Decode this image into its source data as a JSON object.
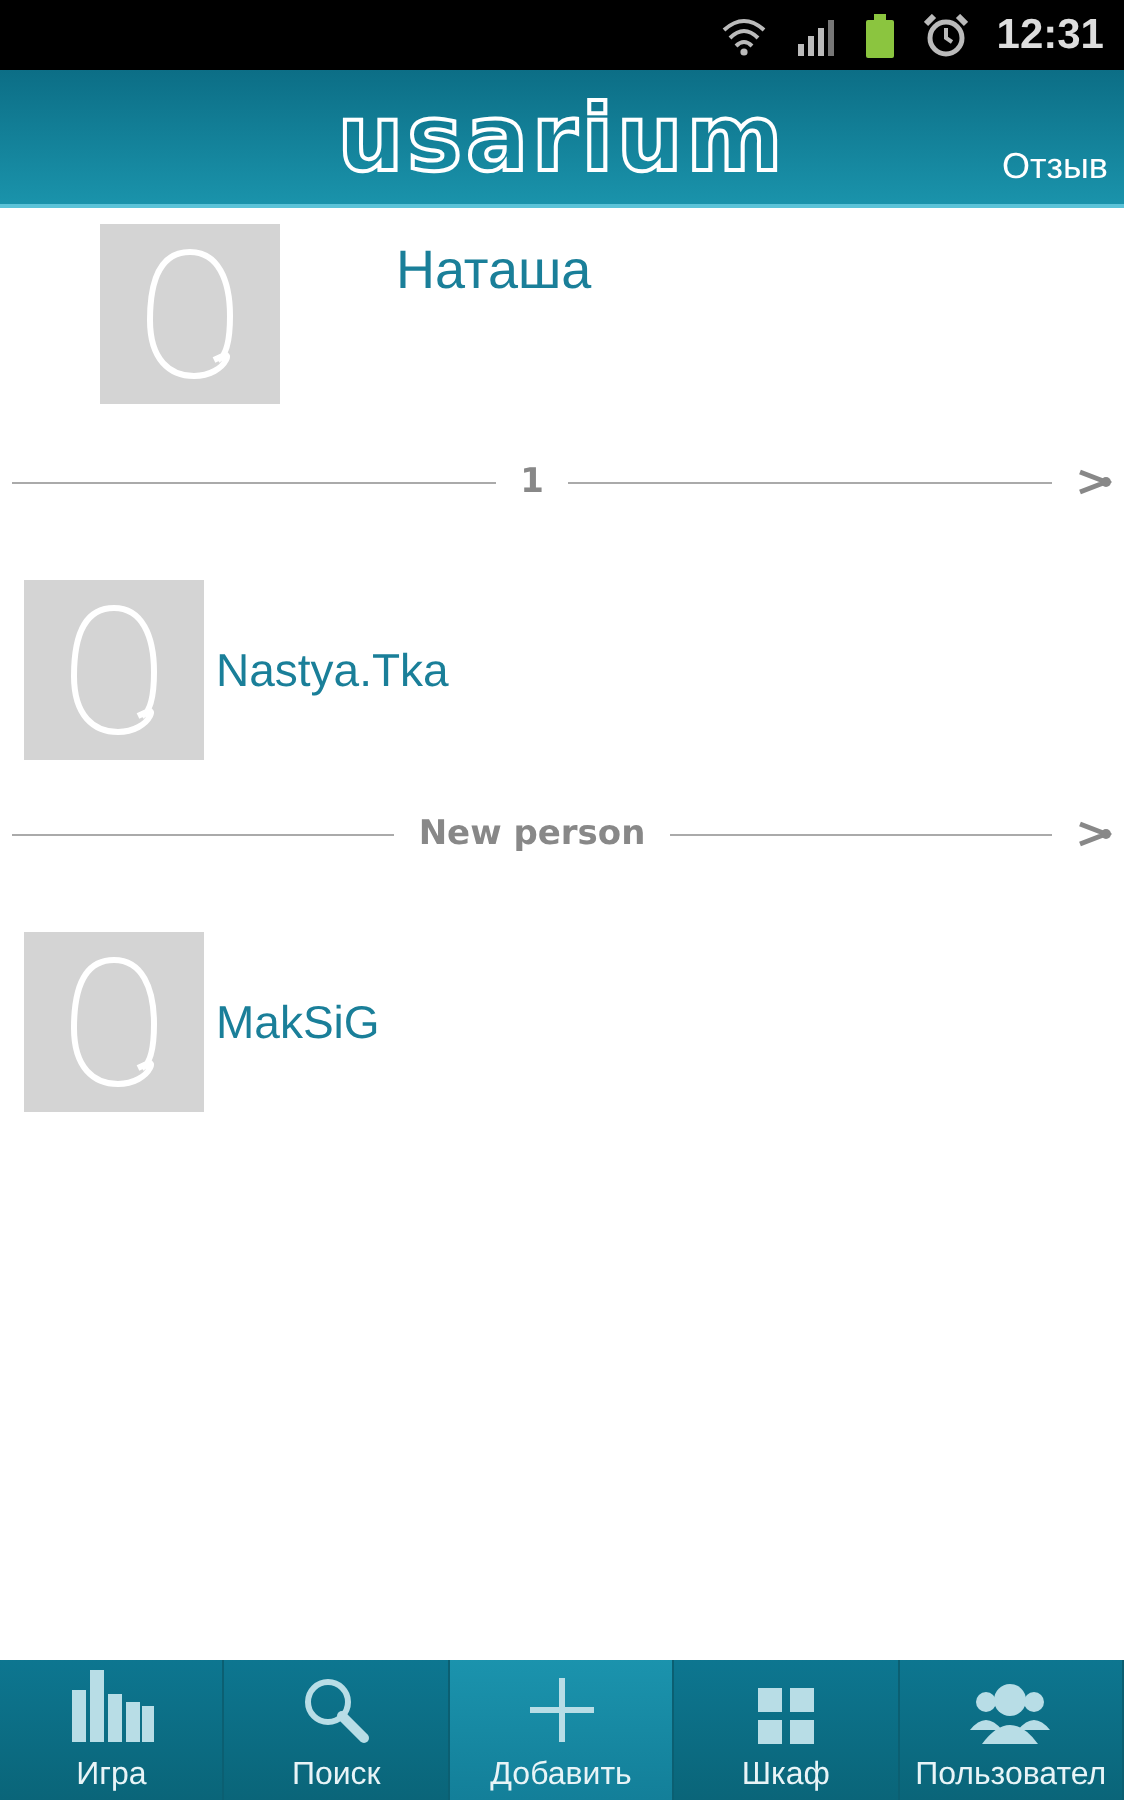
{
  "status_bar": {
    "time": "12:31"
  },
  "header": {
    "logo": "usarium",
    "action": "Отзыв"
  },
  "featured": {
    "name": "Наташа"
  },
  "sections": [
    {
      "label": "1",
      "people": [
        {
          "name": "Nastya.Tka"
        }
      ]
    },
    {
      "label": "New person",
      "people": [
        {
          "name": "MakSiG"
        }
      ]
    }
  ],
  "nav": [
    {
      "kind": "game",
      "label": "Игра",
      "selected": false
    },
    {
      "kind": "search",
      "label": "Поиск",
      "selected": false
    },
    {
      "kind": "add",
      "label": "Добавить",
      "selected": true
    },
    {
      "kind": "grid",
      "label": "Шкаф",
      "selected": false
    },
    {
      "kind": "users",
      "label": "Пользовател",
      "selected": false
    }
  ]
}
